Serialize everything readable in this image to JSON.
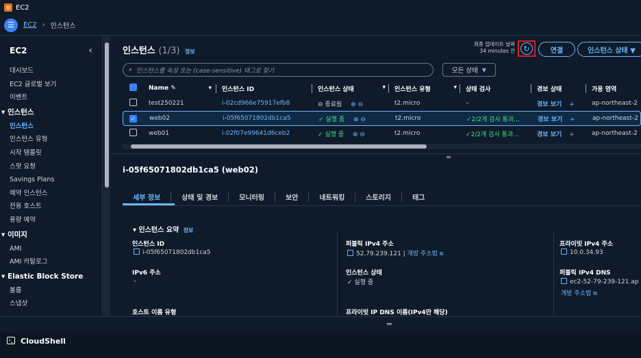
{
  "app": {
    "title": "EC2",
    "logo_glyph": "⚙"
  },
  "breadcrumb": {
    "root": "EC2",
    "current": "인스턴스"
  },
  "sidebar": {
    "title": "EC2",
    "items_top": [
      "대시보드",
      "EC2 글로벌 보기",
      "이벤트"
    ],
    "sections": [
      {
        "title": "인스턴스",
        "items": [
          "인스턴스",
          "인스턴스 유형",
          "시작 템플릿",
          "스팟 요청",
          "Savings Plans",
          "예약 인스턴스",
          "전용 호스트",
          "용량 예약"
        ],
        "active": "인스턴스"
      },
      {
        "title": "이미지",
        "items": [
          "AMI",
          "AMI 카탈로그"
        ]
      },
      {
        "title": "Elastic Block Store",
        "items": [
          "볼륨",
          "스냅샷"
        ]
      }
    ]
  },
  "header": {
    "title": "인스턴스",
    "count": "(1/3)",
    "info": "정보",
    "update_label": "최종 업데이트 날짜",
    "update_value": "34 minutes 전",
    "connect": "연결",
    "instance_state": "인스턴스 상태 ▼"
  },
  "search": {
    "placeholder": "인스턴스를 속성 또는 (case-sensitive) 태그로 찾기"
  },
  "filter": {
    "label": "모든 상태"
  },
  "table": {
    "columns": [
      "Name",
      "인스턴스 ID",
      "인스턴스 상태",
      "인스턴스 유형",
      "상태 검사",
      "경보 상태",
      "가용 영역"
    ],
    "rows": [
      {
        "name": "test250221",
        "id": "i-02cd966e75917efb8",
        "state": "종료됨",
        "state_kind": "stopped",
        "type": "t2.micro",
        "check": "–",
        "alarm": "경보 보기",
        "zone": "ap-northeast-2",
        "selected": false
      },
      {
        "name": "web02",
        "id": "i-05f65071802db1ca5",
        "state": "실행 중",
        "state_kind": "running",
        "type": "t2.micro",
        "check": "2/2개 검사 통과...",
        "alarm": "경보 보기",
        "zone": "ap-northeast-2",
        "selected": true
      },
      {
        "name": "web01",
        "id": "i-02f07e99641d6ceb2",
        "state": "실행 중",
        "state_kind": "running",
        "type": "t2.micro",
        "check": "2/2개 검사 통과...",
        "alarm": "경보 보기",
        "zone": "ap-northeast-2",
        "selected": false
      }
    ]
  },
  "detail": {
    "title": "i-05f65071802db1ca5 (web02)",
    "tabs": [
      "세부 정보",
      "상태 및 경보",
      "모니터링",
      "보안",
      "네트워킹",
      "스토리지",
      "태그"
    ],
    "summary": "인스턴스 요약",
    "summary_info": "정보",
    "fields": {
      "instance_id_label": "인스턴스 ID",
      "instance_id": "i-05f65071802db1ca5",
      "public_ip_label": "퍼블릭 IPv4 주소",
      "public_ip": "52.79.239.121",
      "open_addr": "개방 주소법",
      "private_ip_label": "프라이빗 IPv4 주소",
      "private_ip": "10.0.34.93",
      "ipv6_label": "IPv6 주소",
      "ipv6": "–",
      "state_label": "인스턴스 상태",
      "state": "실행 중",
      "public_dns_label": "퍼블릭 IPv4 DNS",
      "public_dns": "ec2-52-79-239-121.ap",
      "hostname_label": "호스트 이름 유형",
      "private_dns_label": "프라이빗 IP DNS 이름(IPv4만 해당)"
    }
  },
  "cloudshell": {
    "label": "CloudShell"
  }
}
